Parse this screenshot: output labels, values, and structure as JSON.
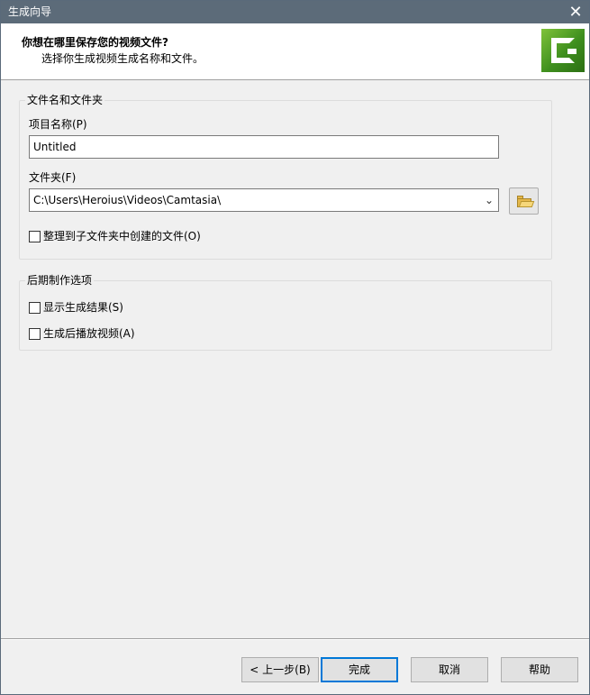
{
  "window": {
    "title": "生成向导",
    "close_glyph": "✕"
  },
  "header": {
    "title": "你想在哪里保存您的视频文件?",
    "subtitle": "选择你生成视频生成名称和文件。",
    "logo_icon": "camtasia-logo-icon",
    "logo_color": "#5aa82a"
  },
  "file_group": {
    "legend": "文件名和文件夹",
    "project_name_label": "项目名称(P)",
    "project_name_value": "Untitled",
    "folder_label": "文件夹(F)",
    "folder_value": "C:\\Users\\Heroius\\Videos\\Camtasia\\",
    "dropdown_glyph": "⌄",
    "browse_icon": "open-folder-icon",
    "organize_checkbox_label": "整理到子文件夹中创建的文件(O)",
    "organize_checked": false
  },
  "post_group": {
    "legend": "后期制作选项",
    "show_results_label": "显示生成结果(S)",
    "show_results_checked": false,
    "play_video_label": "生成后播放视频(A)",
    "play_video_checked": false
  },
  "buttons": {
    "back": "< 上一步(B)",
    "finish": "完成",
    "cancel": "取消",
    "help": "帮助"
  }
}
